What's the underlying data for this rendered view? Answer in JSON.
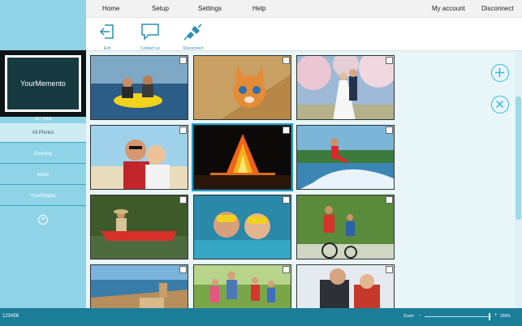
{
  "menu": {
    "home": "Home",
    "setup": "Setup",
    "settings": "Settings",
    "help": "Help",
    "my_account": "My account",
    "disconnect": "Disconnect"
  },
  "toolbar": {
    "exit": "Exit",
    "contact": "Contact us",
    "disconnect": "Disconnect"
  },
  "sidebar": {
    "memento_title": "YourMemento",
    "photo_count": "18 / 3000",
    "items": [
      "All Photos",
      "Evening",
      "Inbox",
      "YourPlaylist"
    ]
  },
  "photos": [
    {
      "name": "tube-riding"
    },
    {
      "name": "kitten"
    },
    {
      "name": "wedding-couple"
    },
    {
      "name": "couple-beach"
    },
    {
      "name": "bonfire",
      "selected": true
    },
    {
      "name": "wakeboard"
    },
    {
      "name": "canoe-man"
    },
    {
      "name": "snorkel-couple"
    },
    {
      "name": "bike-family"
    },
    {
      "name": "coastal-town"
    },
    {
      "name": "family-bikes-forest"
    },
    {
      "name": "snow-couple"
    }
  ],
  "status": {
    "code": "123456",
    "zoom_label": "Zoom",
    "zoom_minus": "-",
    "zoom_plus": "+",
    "zoom_value": "150%",
    "zoom_level": 0.97
  },
  "colors": {
    "sidebar": "#8fd3e6",
    "statusbar": "#1c7d98",
    "accent": "#35b7dd"
  }
}
